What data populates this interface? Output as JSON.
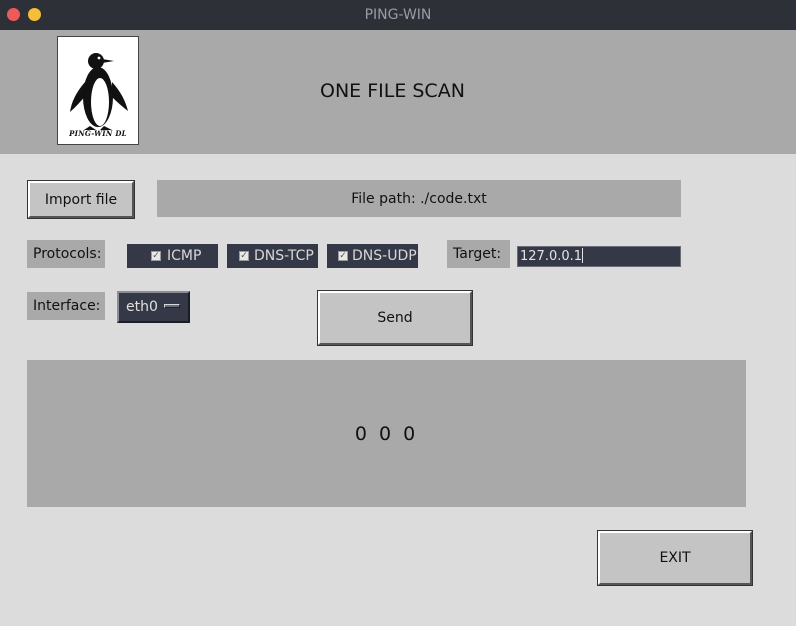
{
  "window": {
    "title": "PING-WIN"
  },
  "header": {
    "title": "ONE FILE SCAN",
    "logo_caption": "PING-WIN DL"
  },
  "file": {
    "import_label": "Import file",
    "path_text": "File path: ./code.txt"
  },
  "protocols": {
    "label": "Protocols:",
    "items": [
      {
        "label": "ICMP",
        "checked": true
      },
      {
        "label": "DNS-TCP",
        "checked": true
      },
      {
        "label": "DNS-UDP",
        "checked": true
      }
    ]
  },
  "target": {
    "label": "Target:",
    "value": "127.0.0.1"
  },
  "interface": {
    "label": "Interface:",
    "selected": "eth0"
  },
  "actions": {
    "send_label": "Send",
    "exit_label": "EXIT"
  },
  "result": {
    "text": "0 0 0"
  },
  "colors": {
    "titlebar": "#2e3037",
    "header_bg": "#a9a9a9",
    "body_bg": "#dcdcdc",
    "dark_widget": "#353947"
  }
}
